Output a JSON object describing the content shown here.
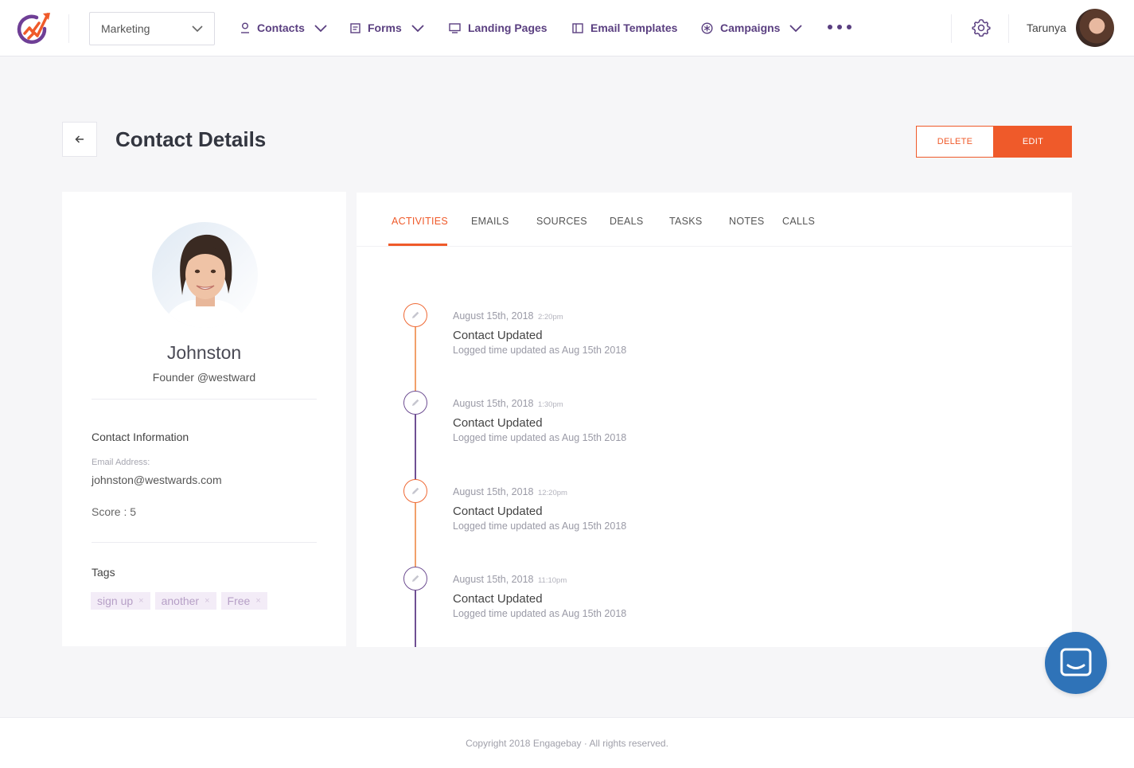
{
  "header": {
    "workspace": "Marketing",
    "nav": {
      "contacts": "Contacts",
      "forms": "Forms",
      "landing_pages": "Landing Pages",
      "email_templates": "Email Templates",
      "campaigns": "Campaigns"
    },
    "user_name": "Tarunya"
  },
  "page": {
    "title": "Contact Details",
    "delete_label": "DELETE",
    "edit_label": "EDIT"
  },
  "profile": {
    "name": "Johnston",
    "role": "Founder @westward",
    "contact_info_title": "Contact Information",
    "email_label": "Email Address:",
    "email": "johnston@westwards.com",
    "score": "Score : 5",
    "tags_title": "Tags",
    "tags": [
      {
        "label": "sign up",
        "remove": "×"
      },
      {
        "label": "another",
        "remove": "×"
      },
      {
        "label": "Free",
        "remove": "×"
      }
    ]
  },
  "tabs": {
    "activities": "ACTIVITIES",
    "emails": "EMAILS",
    "sources": "SOURCES",
    "deals": "DEALS",
    "tasks": "TASKS",
    "notes": "NOTES",
    "calls": "CALLS"
  },
  "activities": [
    {
      "date": "August 15th, 2018",
      "time": "2:20pm",
      "title": "Contact Updated",
      "description": "Logged time updated as Aug 15th 2018"
    },
    {
      "date": "August 15th, 2018",
      "time": "1:30pm",
      "title": "Contact Updated",
      "description": "Logged time updated as Aug 15th 2018"
    },
    {
      "date": "August 15th, 2018",
      "time": "12:20pm",
      "title": "Contact Updated",
      "description": "Logged time updated as Aug 15th 2018"
    },
    {
      "date": "August 15th, 2018",
      "time": "11:10pm",
      "title": "Contact Updated",
      "description": "Logged time updated as Aug 15th 2018"
    }
  ],
  "footer": {
    "copyright": "Copyright 2018 Engagebay · All rights reserved."
  },
  "colors": {
    "accent": "#ef5a2a",
    "brand_purple": "#5a3f80",
    "chat_blue": "#2f73b8"
  },
  "icons": [
    "app-logo",
    "chevron-down-icon",
    "contacts-icon",
    "forms-icon",
    "landing-pages-icon",
    "email-templates-icon",
    "campaigns-icon",
    "more-icon",
    "gear-icon",
    "back-arrow-icon",
    "pencil-icon",
    "chat-icon"
  ]
}
